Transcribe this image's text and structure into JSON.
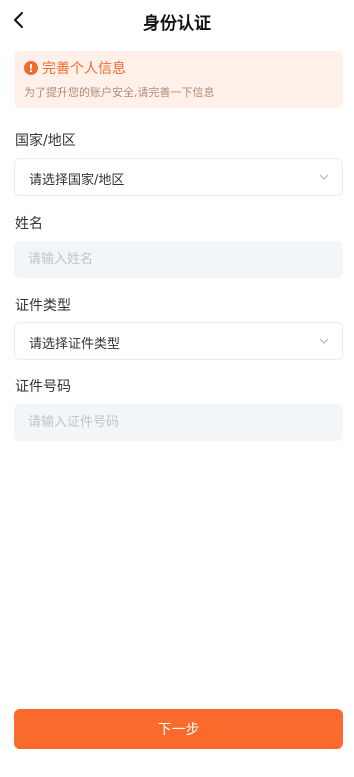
{
  "header": {
    "title": "身份认证"
  },
  "notice": {
    "icon_glyph": "!",
    "title": "完善个人信息",
    "subtitle": "为了提升您的账户安全,请完善一下信息"
  },
  "form": {
    "country": {
      "label": "国家/地区",
      "value": "请选择国家/地区"
    },
    "name": {
      "label": "姓名",
      "placeholder": "请输入姓名",
      "value": ""
    },
    "id_type": {
      "label": "证件类型",
      "value": "请选择证件类型"
    },
    "id_number": {
      "label": "证件号码",
      "placeholder": "请输入证件号码",
      "value": ""
    }
  },
  "actions": {
    "next_label": "下一步"
  },
  "colors": {
    "accent": "#fa6a2d",
    "notice_bg": "#fff1ea",
    "input_bg": "#f3f6f9"
  }
}
